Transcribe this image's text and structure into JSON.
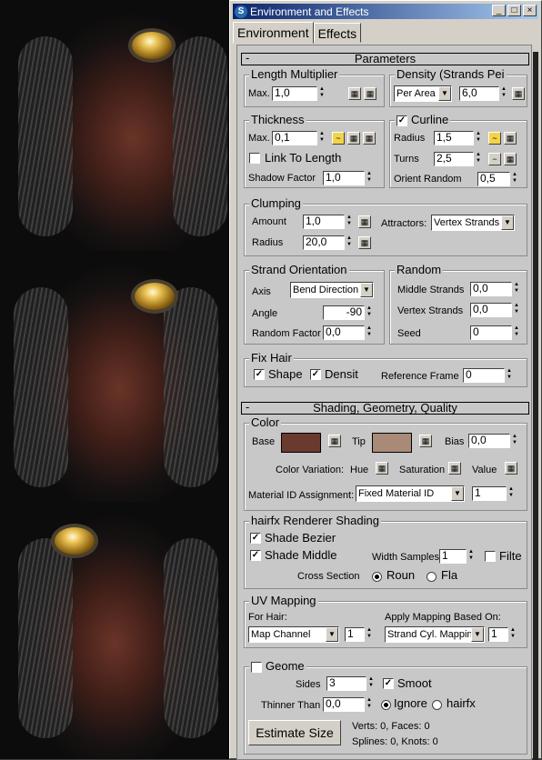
{
  "window": {
    "title": "Environment and Effects",
    "buttons": {
      "minimize": "_",
      "maximize": "□",
      "close": "×"
    }
  },
  "tabs": [
    "Environment",
    "Effects"
  ],
  "parameters": {
    "header": "Parameters",
    "collapse": "-",
    "length_multiplier": {
      "label": "Length Multiplier",
      "max_label": "Max.",
      "max_value": "1,0"
    },
    "density": {
      "label": "Density (Strands Pei",
      "mode": "Per Area",
      "value": "6,0"
    },
    "thickness": {
      "label": "Thickness",
      "max_label": "Max.",
      "max_value": "0,1",
      "link_to_length": "Link To Length",
      "shadow_factor_label": "Shadow Factor",
      "shadow_factor": "1,0"
    },
    "curline": {
      "label": "Curline",
      "checked": true,
      "radius_label": "Radius",
      "radius": "1,5",
      "turns_label": "Turns",
      "turns": "2,5",
      "orient_label": "Orient Random",
      "orient": "0,5"
    },
    "clumping": {
      "label": "Clumping",
      "amount_label": "Amount",
      "amount": "1,0",
      "radius_label": "Radius",
      "radius": "20,0",
      "attractors_label": "Attractors:",
      "attractors": "Vertex Strands"
    },
    "strand_orientation": {
      "label": "Strand Orientation",
      "axis_label": "Axis",
      "axis": "Bend Direction",
      "angle_label": "Angle",
      "angle": "-90",
      "random_label": "Random Factor",
      "random": "0,0"
    },
    "random": {
      "label": "Random",
      "middle_label": "Middle Strands",
      "middle": "0,0",
      "vertex_label": "Vertex Strands",
      "vertex": "0,0",
      "seed_label": "Seed",
      "seed": "0"
    },
    "fix_hair": {
      "label": "Fix Hair",
      "shape": "Shape",
      "density": "Densit",
      "ref_label": "Reference Frame",
      "ref": "0"
    }
  },
  "shading": {
    "header": "Shading, Geometry, Quality",
    "collapse": "-",
    "color": {
      "label": "Color",
      "base_label": "Base",
      "tip_label": "Tip",
      "bias_label": "Bias",
      "bias": "0,0",
      "base_color": "#6b3a2e",
      "tip_color": "#a88a76",
      "variation_label": "Color Variation:",
      "hue": "Hue",
      "saturation": "Saturation",
      "value": "Value",
      "matid_label": "Material ID Assignment:",
      "matid_mode": "Fixed Material ID",
      "matid": "1"
    },
    "renderer": {
      "label": "hairfx Renderer Shading",
      "bezier": "Shade Bezier",
      "middle": "Shade Middle",
      "width_label": "Width Samples",
      "width": "1",
      "filter": "Filte",
      "cross_label": "Cross Section",
      "round": "Roun",
      "flat": "Fla"
    },
    "uv": {
      "label": "UV Mapping",
      "for_hair": "For Hair:",
      "channel_mode": "Map Channel",
      "channel": "1",
      "apply_label": "Apply Mapping Based On:",
      "apply_mode": "Strand Cyl. Mappin",
      "apply_value": "1"
    },
    "geometry": {
      "label": "Geome",
      "sides_label": "Sides",
      "sides": "3",
      "smooth": "Smoot",
      "thinner_label": "Thinner Than",
      "thinner": "0,0",
      "ignore": "Ignore",
      "hairfx": "hairfx",
      "estimate": "Estimate Size",
      "stats1": "Verts: 0, Faces: 0",
      "stats2": "Splines: 0, Knots: 0"
    }
  }
}
